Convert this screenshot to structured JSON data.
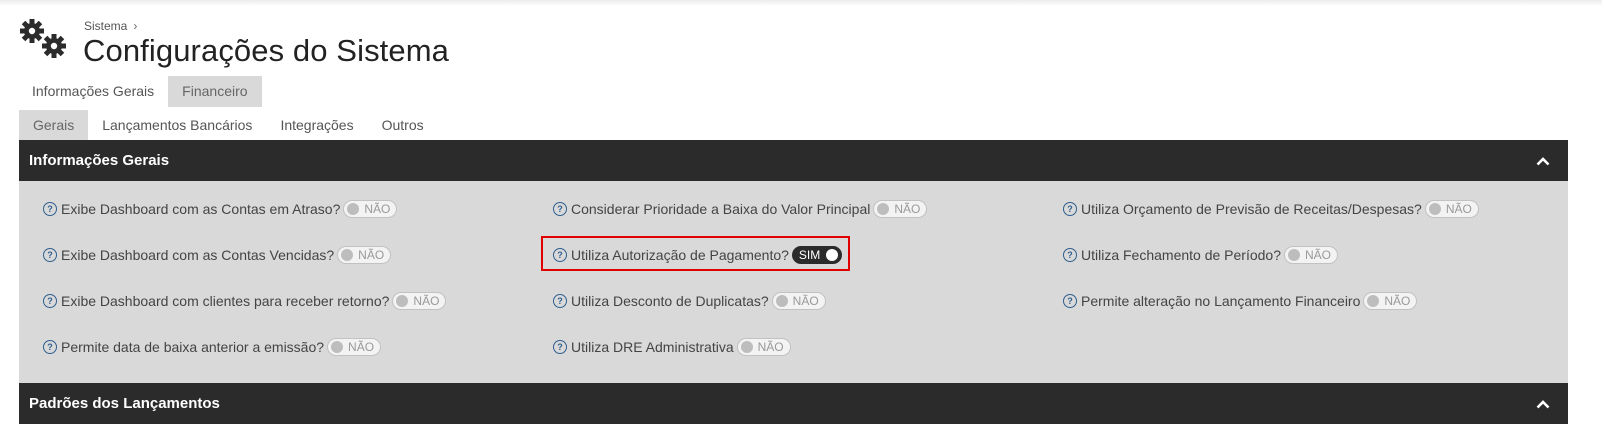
{
  "breadcrumb": {
    "parent": "Sistema",
    "separator": "›"
  },
  "page_title": "Configurações do Sistema",
  "primary_tabs": [
    {
      "label": "Informações Gerais",
      "active": false
    },
    {
      "label": "Financeiro",
      "active": true
    }
  ],
  "secondary_tabs": [
    {
      "label": "Gerais",
      "active": true
    },
    {
      "label": "Lançamentos Bancários",
      "active": false
    },
    {
      "label": "Integrações",
      "active": false
    },
    {
      "label": "Outros",
      "active": false
    }
  ],
  "sections": [
    {
      "title": "Informações Gerais",
      "settings": [
        {
          "label": "Exibe Dashboard com as Contas em Atraso?",
          "value": "NÃO"
        },
        {
          "label": "Considerar Prioridade a Baixa do Valor Principal",
          "value": "NÃO"
        },
        {
          "label": "Utiliza Orçamento de Previsão de Receitas/Despesas?",
          "value": "NÃO"
        },
        {
          "label": "Exibe Dashboard com as Contas Vencidas?",
          "value": "NÃO"
        },
        {
          "label": "Utiliza Autorização de Pagamento?",
          "value": "SIM"
        },
        {
          "label": "Utiliza Fechamento de Período?",
          "value": "NÃO"
        },
        {
          "label": "Exibe Dashboard com clientes para receber retorno?",
          "value": "NÃO"
        },
        {
          "label": "Utiliza Desconto de Duplicatas?",
          "value": "NÃO"
        },
        {
          "label": "Permite alteração no Lançamento Financeiro",
          "value": "NÃO"
        },
        {
          "label": "Permite data de baixa anterior a emissão?",
          "value": "NÃO"
        },
        {
          "label": "Utiliza DRE Administrativa",
          "value": "NÃO"
        }
      ]
    },
    {
      "title": "Padrões dos Lançamentos"
    }
  ],
  "help_glyph": "?",
  "colors": {
    "header_bg": "#2b2b2b",
    "panel_bg": "#d9d9d9",
    "help_icon": "#2f5f8f",
    "highlight": "#e00000"
  }
}
